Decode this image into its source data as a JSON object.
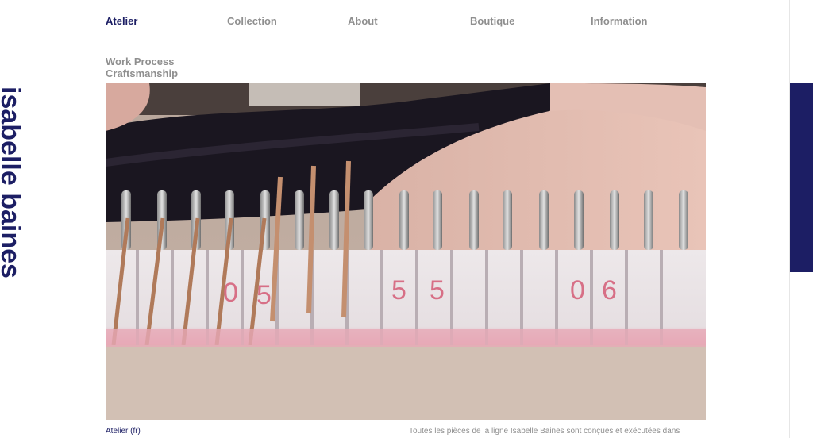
{
  "brand": {
    "name": "isabelle baines"
  },
  "nav": {
    "items": [
      {
        "label": "Atelier",
        "active": true
      },
      {
        "label": "Collection",
        "active": false
      },
      {
        "label": "About",
        "active": false
      },
      {
        "label": "Boutique",
        "active": false
      },
      {
        "label": "Information",
        "active": false
      }
    ]
  },
  "subnav": {
    "items": [
      {
        "label": "Work Process"
      },
      {
        "label": "Craftsmanship"
      }
    ]
  },
  "photo": {
    "description_alt": "Close-up of knitting machine needles",
    "scale_numbers": [
      "0",
      "5",
      "5",
      "5",
      "0",
      "6"
    ]
  },
  "footer": {
    "language_link": "Atelier (fr)",
    "caption": "Toutes les pièces de la ligne Isabelle Baines sont conçues et exécutées dans"
  },
  "colors": {
    "brand": "#1c1e64",
    "nav_inactive": "#8f8f8f"
  }
}
